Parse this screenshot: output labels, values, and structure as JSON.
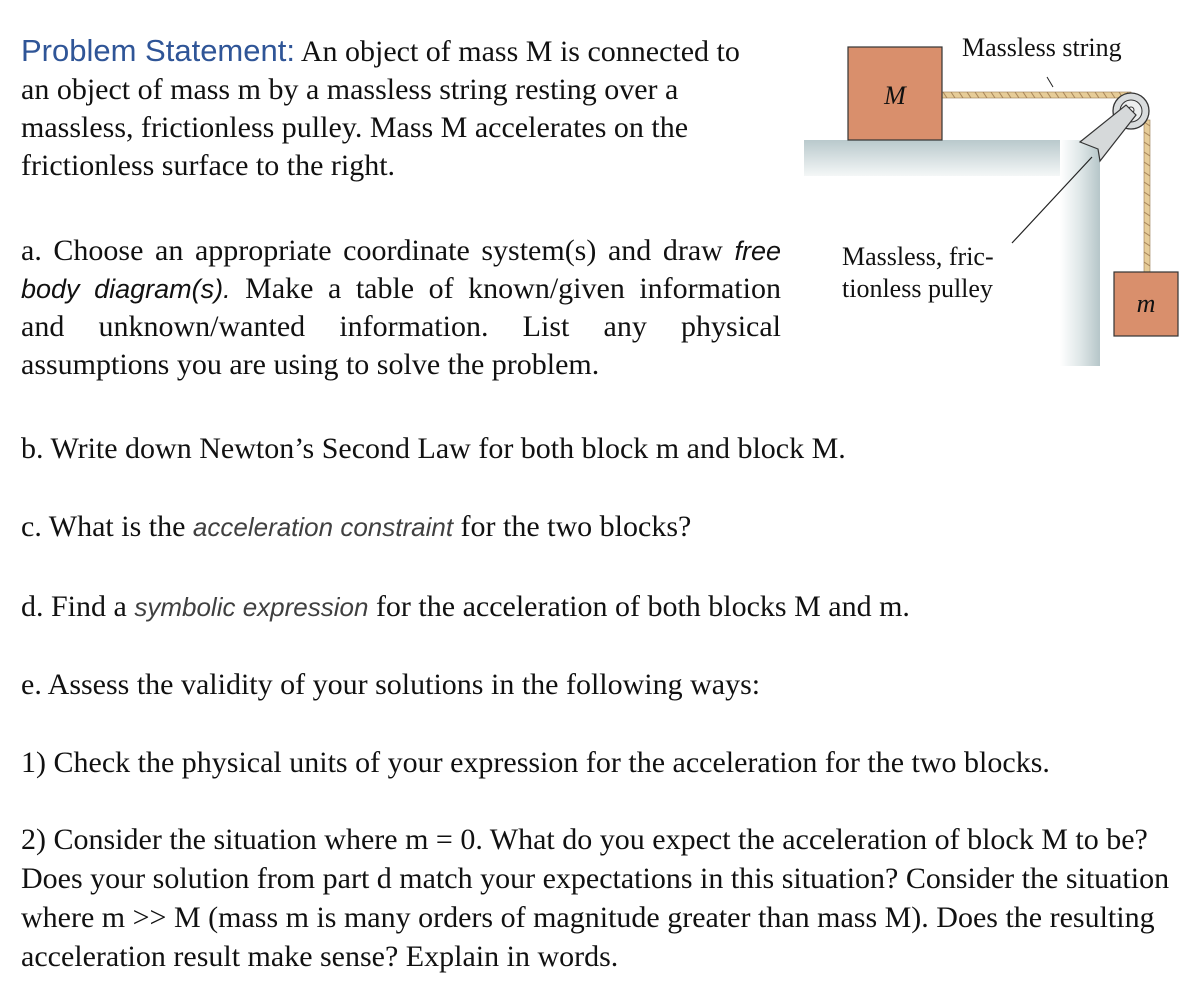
{
  "problem": {
    "heading": "Problem Statement:",
    "text": " An object of mass M is connected to an object of mass m by a massless string resting over a massless, frictionless pulley. Mass M accelerates on the frictionless surface to the right."
  },
  "diagram": {
    "string_label": "Massless string",
    "pulley_label_line1": "Massless, fric-",
    "pulley_label_line2": "tionless pulley",
    "block_big_label": "M",
    "block_small_label": "m",
    "colors": {
      "block": "#d98f6c",
      "rope": "#e2c48e",
      "surface": "#c5d3d6",
      "pulley": "#d9dcdd"
    }
  },
  "parts": {
    "a": {
      "prefix": "a. Choose an appropriate coordinate system(s) and draw ",
      "emphasis": "free body diagram(s).",
      "suffix": " Make a table of known/given information and unknown/wanted information. List any physical assumptions you are using to solve the problem."
    },
    "b": {
      "text": "b. Write down Newton’s Second Law for both block m and block M."
    },
    "c": {
      "prefix": "c. What is the ",
      "emphasis": "acceleration constraint",
      "suffix": " for the two blocks?"
    },
    "d": {
      "prefix": "d. Find a ",
      "emphasis": "symbolic expression",
      "suffix": " for the acceleration of both blocks M and m."
    },
    "e": {
      "text": "e. Assess the validity of your solutions in the following ways:",
      "item1": "1) Check the physical units of your expression for the acceleration for the two blocks.",
      "item2": "2) Consider the situation where m = 0. What do you expect the acceleration of block M to be? Does your solution from part d match your expectations in this situation? Consider the situation where m >> M (mass m is many orders of magnitude greater than mass M). Does the resulting acceleration result make sense? Explain in words."
    }
  }
}
